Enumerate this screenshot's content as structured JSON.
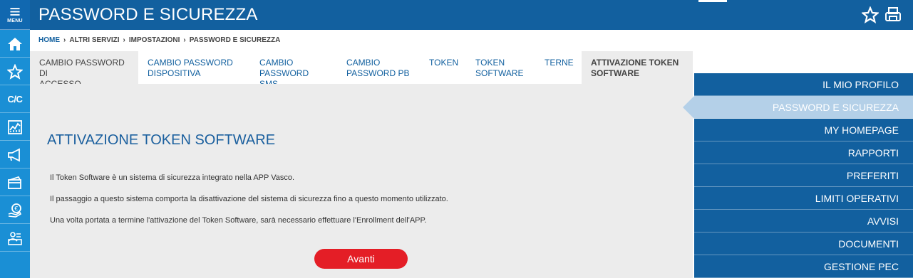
{
  "rail": {
    "menu_label": "MENU",
    "cc_label": "C/C",
    "icons": [
      "menu-icon",
      "home-icon",
      "star-icon",
      "cc-icon",
      "chart-icon",
      "megaphone-icon",
      "cards-icon",
      "euro-hand-icon",
      "person-list-icon"
    ]
  },
  "header": {
    "title": "PASSWORD E SICUREZZA",
    "icons": [
      "star-icon",
      "print-icon"
    ]
  },
  "breadcrumb": {
    "items": [
      "HOME",
      "ALTRI SERVIZI",
      "IMPOSTAZIONI",
      "PASSWORD E SICUREZZA"
    ],
    "separator": "›"
  },
  "tabs": [
    {
      "line1": "CAMBIO PASSWORD DI",
      "line2": "ACCESSO"
    },
    {
      "line1": "CAMBIO PASSWORD",
      "line2": "DISPOSITIVA"
    },
    {
      "line1": "CAMBIO",
      "line2": "PASSWORD SMS"
    },
    {
      "line1": "CAMBIO",
      "line2": "PASSWORD PB"
    },
    {
      "line1": "TOKEN",
      "line2": ""
    },
    {
      "line1": "TOKEN",
      "line2": "SOFTWARE"
    },
    {
      "line1": "TERNE",
      "line2": ""
    },
    {
      "line1": "ATTIVAZIONE TOKEN",
      "line2": "SOFTWARE"
    }
  ],
  "main": {
    "title": "ATTIVAZIONE TOKEN SOFTWARE",
    "paragraphs": [
      "Il Token Software è un sistema di sicurezza integrato nella APP Vasco.",
      "Il passaggio a questo sistema comporta la disattivazione del sistema di sicurezza fino a questo momento utilizzato.",
      "Una volta portata a termine l'attivazione del Token Software, sarà necessario effettuare l'Enrollment dell'APP."
    ],
    "button_label": "Avanti"
  },
  "right_menu": {
    "items": [
      "IL MIO PROFILO",
      "PASSWORD E SICUREZZA",
      "MY HOMEPAGE",
      "RAPPORTI",
      "PREFERITI",
      "LIMITI OPERATIVI",
      "AVVISI",
      "DOCUMENTI",
      "GESTIONE PEC"
    ],
    "selected": "PASSWORD E SICUREZZA"
  },
  "colors": {
    "rail": "#1a8fd5",
    "header": "#12609f",
    "panel": "#ececec",
    "button": "#e41e26",
    "menu_selected": "#b4d0e8"
  }
}
